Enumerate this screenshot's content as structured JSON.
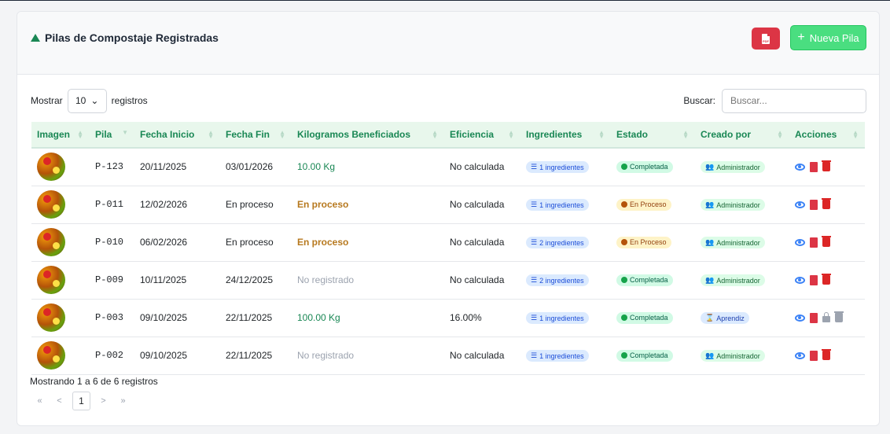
{
  "header": {
    "title": "Pilas de Compostaje Registradas",
    "pdf_icon": "file-pdf-icon",
    "new_button": "Nueva Pila"
  },
  "controls": {
    "show_label": "Mostrar",
    "page_size": "10",
    "records_label": "registros",
    "search_label": "Buscar:",
    "search_placeholder": "Buscar..."
  },
  "table": {
    "columns": [
      "Imagen",
      "Pila",
      "Fecha Inicio",
      "Fecha Fin",
      "Kilogramos Beneficiados",
      "Eficiencia",
      "Ingredientes",
      "Estado",
      "Creado por",
      "Acciones"
    ],
    "rows": [
      {
        "pila": "P-123",
        "inicio": "20/11/2025",
        "fin": "03/01/2026",
        "kg": "10.00 Kg",
        "kg_style": "green",
        "eficiencia": "No calculada",
        "ingredientes": "1 ingredientes",
        "estado": "Completada",
        "estado_style": "completed",
        "creado": "Administrador",
        "creado_style": "admin",
        "locked": false
      },
      {
        "pila": "P-011",
        "inicio": "12/02/2026",
        "fin": "En proceso",
        "kg": "En proceso",
        "kg_style": "orange",
        "eficiencia": "No calculada",
        "ingredientes": "1 ingredientes",
        "estado": "En Proceso",
        "estado_style": "progress",
        "creado": "Administrador",
        "creado_style": "admin",
        "locked": false
      },
      {
        "pila": "P-010",
        "inicio": "06/02/2026",
        "fin": "En proceso",
        "kg": "En proceso",
        "kg_style": "orange",
        "eficiencia": "No calculada",
        "ingredientes": "2 ingredientes",
        "estado": "En Proceso",
        "estado_style": "progress",
        "creado": "Administrador",
        "creado_style": "admin",
        "locked": false
      },
      {
        "pila": "P-009",
        "inicio": "10/11/2025",
        "fin": "24/12/2025",
        "kg": "No registrado",
        "kg_style": "muted",
        "eficiencia": "No calculada",
        "ingredientes": "2 ingredientes",
        "estado": "Completada",
        "estado_style": "completed",
        "creado": "Administrador",
        "creado_style": "admin",
        "locked": false
      },
      {
        "pila": "P-003",
        "inicio": "09/10/2025",
        "fin": "22/11/2025",
        "kg": "100.00 Kg",
        "kg_style": "green",
        "eficiencia": "16.00%",
        "ingredientes": "1 ingredientes",
        "estado": "Completada",
        "estado_style": "completed",
        "creado": "Aprendiz",
        "creado_style": "apr",
        "locked": true
      },
      {
        "pila": "P-002",
        "inicio": "09/10/2025",
        "fin": "22/11/2025",
        "kg": "No registrado",
        "kg_style": "muted",
        "eficiencia": "No calculada",
        "ingredientes": "1 ingredientes",
        "estado": "Completada",
        "estado_style": "completed",
        "creado": "Administrador",
        "creado_style": "admin",
        "locked": false
      }
    ]
  },
  "footer": {
    "info": "Mostrando 1 a 6 de 6 registros",
    "first": "«",
    "prev": "<",
    "current_page": "1",
    "next": ">",
    "last": "»"
  },
  "colors": {
    "accent_green": "#198754",
    "danger": "#dc3545",
    "new_button": "#4ade80"
  }
}
